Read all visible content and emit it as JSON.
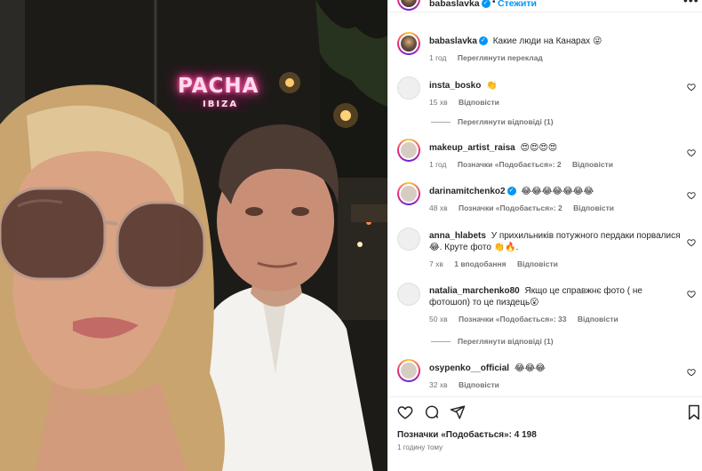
{
  "photo": {
    "alt": "selfie",
    "neon_main": "PACHA",
    "neon_sub": "IBIZA"
  },
  "header": {
    "username": "babaslavka",
    "dot": "•",
    "follow_label": "Стежити",
    "more_icon": "more-horizontal-icon"
  },
  "caption": {
    "username": "babaslavka",
    "text": "Какие люди на Канарах 😜",
    "time": "1 год",
    "translate_label": "Переглянути переклад"
  },
  "comments": [
    {
      "username": "insta_bosko",
      "text": "👏",
      "time": "15 хв",
      "likes_label": "",
      "reply_label": "Відповісти",
      "avatar": "plain"
    },
    {
      "username": "makeup_artist_raisa",
      "text": "😍😍😍😍",
      "time": "1 год",
      "likes_label": "Позначки «Подобається»: 2",
      "reply_label": "Відповісти",
      "avatar": "ring"
    },
    {
      "username": "darinamitchenko2",
      "text": "😂😂😂😂😂😂😂",
      "time": "48 хв",
      "likes_label": "Позначки «Подобається»: 2",
      "reply_label": "Відповісти",
      "avatar": "ring",
      "verified": true
    },
    {
      "username": "anna_hlabets",
      "text": "У прихильників потужного пердаки порвалися 😂. Круте фото 👏🔥.",
      "time": "7 хв",
      "likes_label": "1 вподобання",
      "reply_label": "Відповісти",
      "avatar": "plain"
    },
    {
      "username": "natalia_marchenko80",
      "text": "Якщо це справжнє фото ( не фотошоп) то це пиздець😮",
      "time": "50 хв",
      "likes_label": "Позначки «Подобається»: 33",
      "reply_label": "Відповісти",
      "avatar": "plain"
    },
    {
      "username": "osypenko__official",
      "text": "😂😂😂",
      "time": "32 хв",
      "likes_label": "",
      "reply_label": "Відповісти",
      "avatar": "ring"
    }
  ],
  "view_replies": [
    {
      "label": "Переглянути відповіді (1)"
    },
    {
      "label": "Переглянути відповіді (1)"
    }
  ],
  "actions": {
    "like_icon": "heart-icon",
    "comment_icon": "comment-icon",
    "share_icon": "send-icon",
    "save_icon": "bookmark-icon"
  },
  "likes_summary": "Позначки «Подобається»: 4 198",
  "posted_ago": "1 годину тому",
  "colors": {
    "link_blue": "#0095f6",
    "text": "#262626",
    "muted": "#737373",
    "neon_pink": "#ff3d9a"
  }
}
